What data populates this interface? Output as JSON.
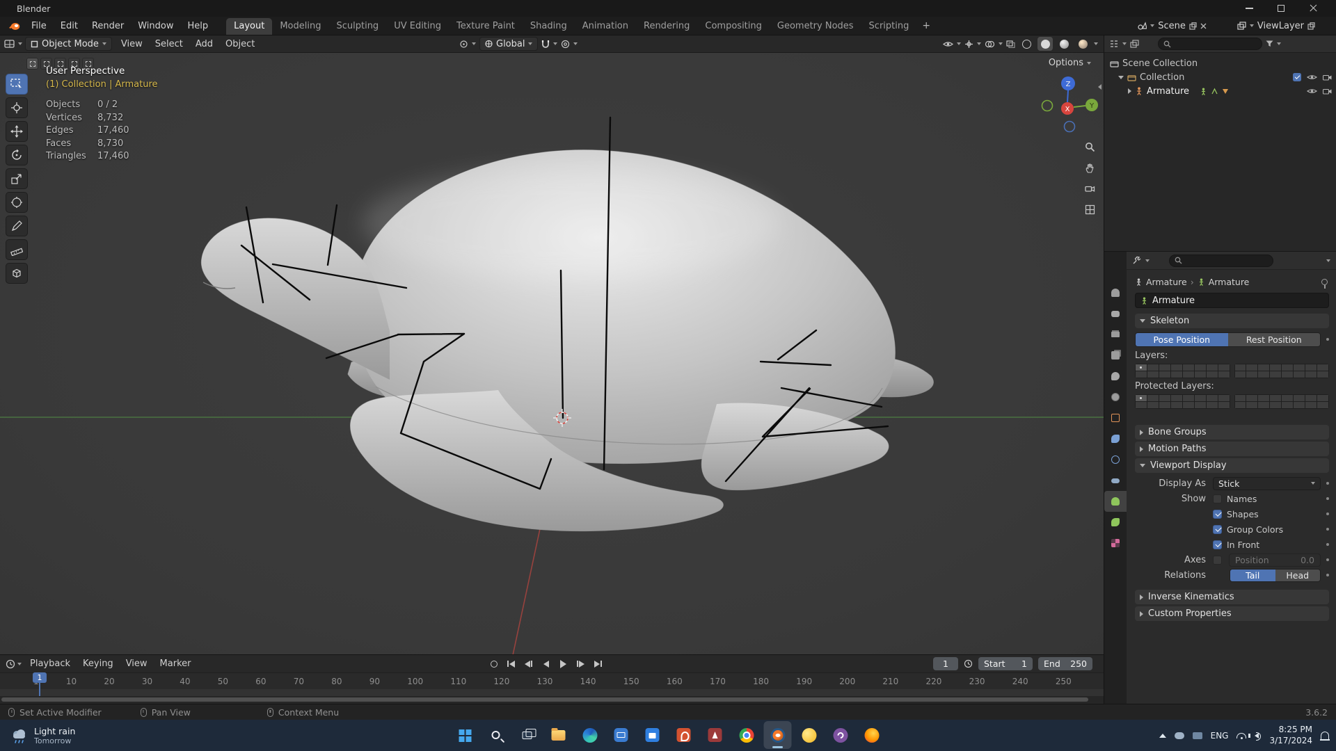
{
  "titlebar": {
    "title": "Blender"
  },
  "menubar": {
    "menus": [
      "File",
      "Edit",
      "Render",
      "Window",
      "Help"
    ],
    "workspaces": [
      {
        "label": "Layout",
        "active": true
      },
      {
        "label": "Modeling"
      },
      {
        "label": "Sculpting"
      },
      {
        "label": "UV Editing"
      },
      {
        "label": "Texture Paint"
      },
      {
        "label": "Shading"
      },
      {
        "label": "Animation"
      },
      {
        "label": "Rendering"
      },
      {
        "label": "Compositing"
      },
      {
        "label": "Geometry Nodes"
      },
      {
        "label": "Scripting"
      }
    ],
    "add_workspace": "+",
    "scene_label": "Scene",
    "view_layer_label": "ViewLayer"
  },
  "viewport": {
    "header": {
      "mode": "Object Mode",
      "menus": [
        "View",
        "Select",
        "Add",
        "Object"
      ],
      "orientation": "Global",
      "options": "Options"
    },
    "overlay": {
      "perspective": "User Perspective",
      "context": "(1) Collection | Armature",
      "stats": [
        {
          "label": "Objects",
          "value": "0 / 2"
        },
        {
          "label": "Vertices",
          "value": "8,732"
        },
        {
          "label": "Edges",
          "value": "17,460"
        },
        {
          "label": "Faces",
          "value": "8,730"
        },
        {
          "label": "Triangles",
          "value": "17,460"
        }
      ]
    },
    "gizmo": {
      "x": "X",
      "y": "Y",
      "z": "Z"
    }
  },
  "outliner": {
    "scene_collection": "Scene Collection",
    "collection": "Collection",
    "armature": "Armature"
  },
  "properties": {
    "tabs": [
      {
        "name": "tab-tool",
        "cls": "t-tool"
      },
      {
        "name": "tab-render",
        "cls": "t-render"
      },
      {
        "name": "tab-output",
        "cls": "t-output"
      },
      {
        "name": "tab-view-layer",
        "cls": "t-vlayer"
      },
      {
        "name": "tab-scene",
        "cls": "t-scene"
      },
      {
        "name": "tab-world",
        "cls": "t-world"
      },
      {
        "name": "tab-object",
        "cls": "t-object"
      },
      {
        "name": "tab-modifiers",
        "cls": "t-mod"
      },
      {
        "name": "tab-physics",
        "cls": "t-phys"
      },
      {
        "name": "tab-constraints",
        "cls": "t-constr"
      },
      {
        "name": "tab-object-data",
        "cls": "t-data",
        "active": true
      },
      {
        "name": "tab-bone",
        "cls": "t-bone"
      },
      {
        "name": "tab-texture",
        "cls": "t-tex"
      }
    ],
    "breadcrumb_object": "Armature",
    "breadcrumb_data": "Armature",
    "name": "Armature",
    "skeleton": "Skeleton",
    "pose_position": "Pose Position",
    "rest_position": "Rest Position",
    "layers_label": "Layers:",
    "protected_layers_label": "Protected Layers:",
    "bone_groups": "Bone Groups",
    "motion_paths": "Motion Paths",
    "viewport_display": "Viewport Display",
    "inverse_kinematics": "Inverse Kinematics",
    "custom_properties": "Custom Properties",
    "display_as_label": "Display As",
    "display_as_value": "Stick",
    "show_rows": [
      {
        "row_label": "Show",
        "label": "Names",
        "checked": false
      },
      {
        "label": "Shapes",
        "checked": true
      },
      {
        "label": "Group Colors",
        "checked": true
      },
      {
        "label": "In Front",
        "checked": true
      }
    ],
    "axes_label": "Axes",
    "position_label": "Position",
    "position_value": "0.0",
    "relations_label": "Relations",
    "tail": "Tail",
    "head": "Head"
  },
  "timeline": {
    "menus": [
      {
        "label": "Playback",
        "cls": "has-chev"
      },
      {
        "label": "Keying",
        "cls": "has-chev"
      },
      {
        "label": "View"
      },
      {
        "label": "Marker"
      }
    ],
    "current_frame": "1",
    "playhead_frame": "1",
    "start_label": "Start",
    "start_value": "1",
    "end_label": "End",
    "end_value": "250",
    "ticks": [
      "1",
      "10",
      "20",
      "30",
      "40",
      "50",
      "60",
      "70",
      "80",
      "90",
      "100",
      "110",
      "120",
      "130",
      "140",
      "150",
      "160",
      "170",
      "180",
      "190",
      "200",
      "210",
      "220",
      "230",
      "240",
      "250"
    ]
  },
  "statusbar": {
    "hints": [
      "Set Active Modifier",
      "Pan View",
      "Context Menu"
    ],
    "version": "3.6.2"
  },
  "taskbar": {
    "weather_line1": "Light rain",
    "weather_line2": "Tomorrow",
    "apps": [
      {
        "name": "start-button",
        "cls": "start"
      },
      {
        "name": "search-button",
        "cls": "search"
      },
      {
        "name": "task-view-button",
        "cls": "taskview"
      },
      {
        "name": "file-explorer-icon",
        "cls": "explorer"
      },
      {
        "name": "edge-icon",
        "cls": "edge"
      },
      {
        "name": "mail-icon",
        "cls": "mail"
      },
      {
        "name": "store-icon",
        "cls": "store"
      },
      {
        "name": "powerpoint-icon",
        "cls": "ppt"
      },
      {
        "name": "access-icon",
        "cls": "access"
      },
      {
        "name": "chrome-icon",
        "cls": "chrome"
      },
      {
        "name": "blender-icon",
        "cls": "blender",
        "active": true
      },
      {
        "name": "chrome-canary-icon",
        "cls": "canary"
      },
      {
        "name": "viber-icon",
        "cls": "viber"
      },
      {
        "name": "firefox-icon",
        "cls": "firefox"
      }
    ],
    "tray": {
      "lang": "ENG",
      "time": "8:25 PM",
      "date": "3/17/2024"
    }
  }
}
